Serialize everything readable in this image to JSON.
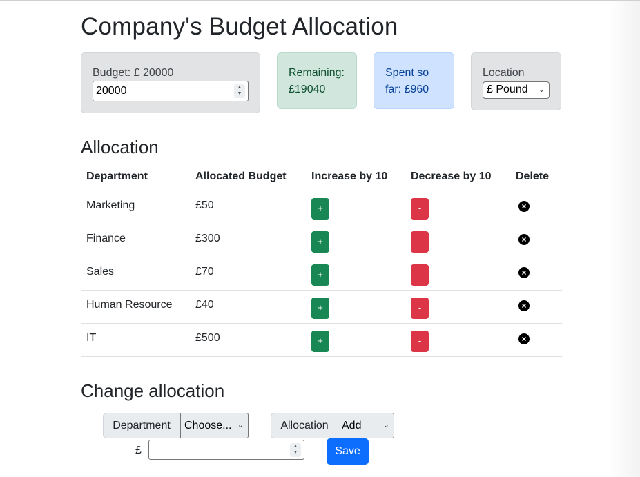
{
  "page_title": "Company's Budget Allocation",
  "cards": {
    "budget": {
      "label": "Budget: £ 20000",
      "input_value": "20000"
    },
    "remaining": {
      "line1": "Remaining:",
      "line2": "£19040"
    },
    "spent": {
      "line1": "Spent so",
      "line2": "far: £960"
    },
    "location": {
      "label": "Location",
      "selected": "£ Pound"
    }
  },
  "allocation": {
    "heading": "Allocation",
    "columns": [
      "Department",
      "Allocated Budget",
      "Increase by 10",
      "Decrease by 10",
      "Delete"
    ],
    "rows": [
      {
        "department": "Marketing",
        "budget": "£50"
      },
      {
        "department": "Finance",
        "budget": "£300"
      },
      {
        "department": "Sales",
        "budget": "£70"
      },
      {
        "department": "Human Resource",
        "budget": "£40"
      },
      {
        "department": "IT",
        "budget": "£500"
      }
    ],
    "increase_label": "+",
    "decrease_label": "-"
  },
  "change": {
    "heading": "Change allocation",
    "department_label": "Department",
    "department_selected": "Choose...",
    "allocation_label": "Allocation",
    "allocation_selected": "Add",
    "currency": "£",
    "amount_value": "",
    "save_label": "Save"
  },
  "colors": {
    "success": "#198754",
    "danger": "#dc3545",
    "primary": "#0d6efd"
  }
}
